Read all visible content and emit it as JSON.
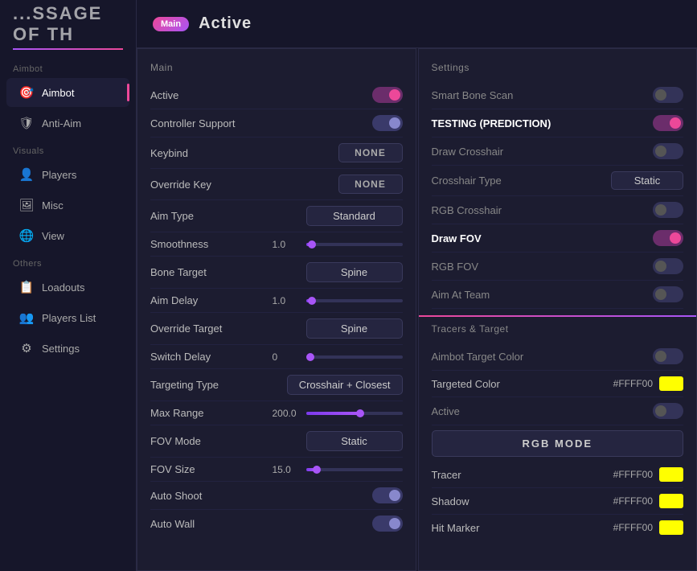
{
  "app": {
    "logo": "...SSAGE OF TH",
    "header": {
      "badge": "Main",
      "title": "Active"
    }
  },
  "sidebar": {
    "sections": [
      {
        "label": "Aimbot",
        "items": [
          {
            "id": "aimbot",
            "label": "Aimbot",
            "icon": "🎯",
            "active": true
          },
          {
            "id": "anti-aim",
            "label": "Anti-Aim",
            "icon": "🛡"
          }
        ]
      },
      {
        "label": "Visuals",
        "items": [
          {
            "id": "players",
            "label": "Players",
            "icon": "👤"
          },
          {
            "id": "misc",
            "label": "Misc",
            "icon": "🖼"
          },
          {
            "id": "view",
            "label": "View",
            "icon": "🌐"
          }
        ]
      },
      {
        "label": "Others",
        "items": [
          {
            "id": "loadouts",
            "label": "Loadouts",
            "icon": "📋"
          },
          {
            "id": "players-list",
            "label": "Players List",
            "icon": "👥"
          },
          {
            "id": "settings",
            "label": "Settings",
            "icon": "⚙"
          }
        ]
      }
    ]
  },
  "left_panel": {
    "section_title": "Main",
    "rows": [
      {
        "id": "active",
        "label": "Active",
        "type": "toggle",
        "state": "on-pink"
      },
      {
        "id": "controller-support",
        "label": "Controller Support",
        "type": "toggle",
        "state": "on"
      },
      {
        "id": "keybind",
        "label": "Keybind",
        "type": "keybind",
        "value": "NONE"
      },
      {
        "id": "override-key",
        "label": "Override Key",
        "type": "keybind",
        "value": "NONE"
      },
      {
        "id": "aim-type",
        "label": "Aim Type",
        "type": "dropdown",
        "value": "Standard"
      },
      {
        "id": "smoothness",
        "label": "Smoothness",
        "type": "slider",
        "value": "1.0",
        "fill_pct": 5
      },
      {
        "id": "bone-target",
        "label": "Bone Target",
        "type": "dropdown",
        "value": "Spine"
      },
      {
        "id": "aim-delay",
        "label": "Aim Delay",
        "type": "slider",
        "value": "1.0",
        "fill_pct": 5
      },
      {
        "id": "override-target",
        "label": "Override Target",
        "type": "dropdown",
        "value": "Spine"
      },
      {
        "id": "switch-delay",
        "label": "Switch Delay",
        "type": "slider",
        "value": "0",
        "fill_pct": 0
      },
      {
        "id": "targeting-type",
        "label": "Targeting Type",
        "type": "dropdown",
        "value": "Crosshair + Closest"
      },
      {
        "id": "max-range",
        "label": "Max Range",
        "type": "slider",
        "value": "200.0",
        "fill_pct": 55
      },
      {
        "id": "fov-mode",
        "label": "FOV Mode",
        "type": "dropdown",
        "value": "Static"
      },
      {
        "id": "fov-size",
        "label": "FOV Size",
        "type": "slider",
        "value": "15.0",
        "fill_pct": 10
      },
      {
        "id": "auto-shoot",
        "label": "Auto Shoot",
        "type": "toggle",
        "state": "on"
      },
      {
        "id": "auto-wall",
        "label": "Auto Wall",
        "type": "toggle",
        "state": "on"
      }
    ]
  },
  "right_panel": {
    "settings_section": {
      "title": "Settings",
      "rows": [
        {
          "id": "smart-bone-scan",
          "label": "Smart Bone Scan",
          "type": "toggle",
          "state": "off"
        },
        {
          "id": "testing-prediction",
          "label": "TESTING (PREDICTION)",
          "type": "toggle",
          "state": "on-pink",
          "bright": true
        },
        {
          "id": "draw-crosshair",
          "label": "Draw Crosshair",
          "type": "toggle",
          "state": "off"
        },
        {
          "id": "crosshair-type",
          "label": "Crosshair Type",
          "type": "crosshair-dropdown",
          "value": "Static"
        },
        {
          "id": "rgb-crosshair",
          "label": "RGB Crosshair",
          "type": "toggle",
          "state": "off"
        },
        {
          "id": "draw-fov",
          "label": "Draw FOV",
          "type": "toggle",
          "state": "on-pink",
          "bright": true
        },
        {
          "id": "rgb-fov",
          "label": "RGB FOV",
          "type": "toggle",
          "state": "off"
        },
        {
          "id": "aim-at-team",
          "label": "Aim At Team",
          "type": "toggle",
          "state": "off"
        }
      ]
    },
    "tracers_section": {
      "title": "Tracers & Target",
      "rows": [
        {
          "id": "aimbot-target-color",
          "label": "Aimbot Target Color",
          "type": "toggle",
          "state": "off"
        },
        {
          "id": "targeted-color",
          "label": "Targeted Color",
          "type": "color",
          "value": "#FFFF00",
          "swatch": "#ffff00"
        },
        {
          "id": "active-tracer",
          "label": "Active",
          "type": "toggle",
          "state": "off"
        },
        {
          "id": "rgb-mode",
          "label": "RGB MODE",
          "type": "button"
        },
        {
          "id": "tracer",
          "label": "Tracer",
          "type": "color",
          "value": "#FFFF00",
          "swatch": "#ffff00"
        },
        {
          "id": "shadow",
          "label": "Shadow",
          "type": "color",
          "value": "#FFFF00",
          "swatch": "#ffff00"
        },
        {
          "id": "hit-marker",
          "label": "Hit Marker",
          "type": "color",
          "value": "#FFFF00",
          "swatch": "#ffff00"
        }
      ]
    }
  },
  "colors": {
    "accent_pink": "#ec4899",
    "accent_purple": "#a855f7",
    "yellow": "#ffff00"
  }
}
